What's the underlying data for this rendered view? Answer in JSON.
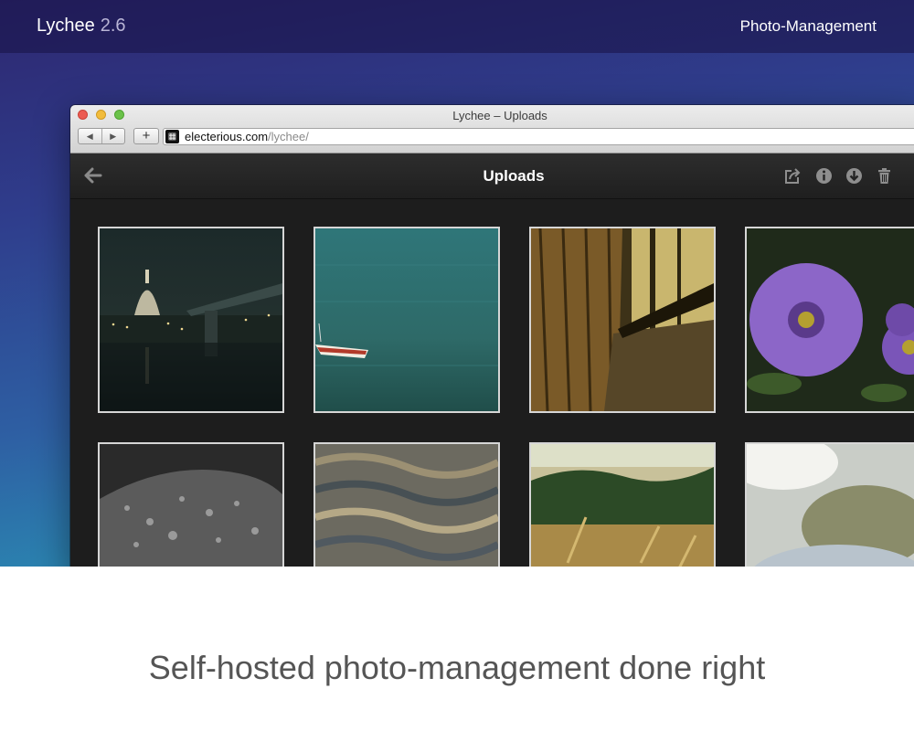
{
  "site": {
    "logo_name": "Lychee",
    "logo_version": "2.6",
    "nav_link": "Photo-Management"
  },
  "browser": {
    "window_title": "Lychee – Uploads",
    "url_domain": "electerious.com",
    "url_path": "/lychee/",
    "back_glyph": "◀",
    "forward_glyph": "▶",
    "add_glyph": "+"
  },
  "app": {
    "title": "Uploads",
    "icons": [
      "back-arrow-icon",
      "share-icon",
      "info-icon",
      "download-icon",
      "trash-icon"
    ]
  },
  "photos": [
    {
      "subject": "city-night-bridge-photo"
    },
    {
      "subject": "boat-on-water-photo"
    },
    {
      "subject": "wooden-interior-photo"
    },
    {
      "subject": "purple-flowers-photo"
    },
    {
      "subject": "wet-rock-photo"
    },
    {
      "subject": "rippled-water-photo"
    },
    {
      "subject": "wheat-field-photo"
    },
    {
      "subject": "blurry-object-photo"
    }
  ],
  "tagline": "Self-hosted photo-management done right",
  "colors": {
    "gradient_top": "#2d2770",
    "gradient_bottom": "#2aa0b8",
    "app_background": "#1d1d1d"
  }
}
